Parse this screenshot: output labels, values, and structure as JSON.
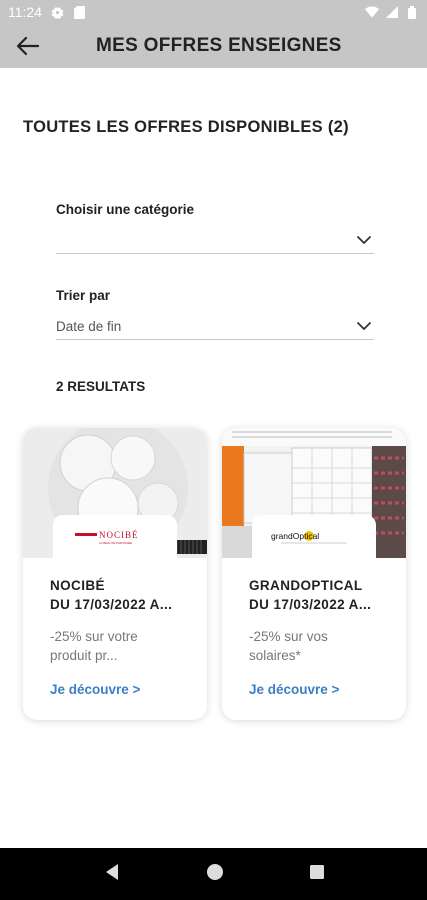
{
  "status_bar": {
    "time": "11:24",
    "icons": [
      "gear-icon",
      "sd-card-icon",
      "wifi-icon",
      "signal-icon",
      "battery-icon"
    ]
  },
  "app_bar": {
    "title": "MES OFFRES ENSEIGNES",
    "back_icon": "arrow-left-icon"
  },
  "section_title": "TOUTES LES OFFRES DISPONIBLES (2)",
  "filters": {
    "category": {
      "label": "Choisir une catégorie",
      "value": ""
    },
    "sort": {
      "label": "Trier par",
      "value": "Date de fin"
    }
  },
  "results_label": "2 RESULTATS",
  "offers": [
    {
      "brand_logo_text": "NOCIBÉ",
      "brand_logo_sub": "LA BEAUTÉ PARTAGÉE",
      "title_line1": "NOCIBÉ",
      "title_line2": "DU 17/03/2022 A...",
      "desc_line1": "-25% sur votre",
      "desc_line2": "produit pr...",
      "link": "Je découvre >"
    },
    {
      "brand_logo_text": "grandOptical",
      "brand_logo_sub": "",
      "title_line1": "GRANDOPTICAL",
      "title_line2": "DU 17/03/2022 A...",
      "desc_line1": "-25% sur vos",
      "desc_line2": "solaires*",
      "link": "Je découvre >"
    }
  ],
  "nav_bar": {
    "icons": [
      "back-triangle-icon",
      "home-circle-icon",
      "recents-square-icon"
    ]
  },
  "colors": {
    "app_bar": "#c6c6c6",
    "link": "#3b7fc4",
    "brand_red": "#c8102e"
  }
}
